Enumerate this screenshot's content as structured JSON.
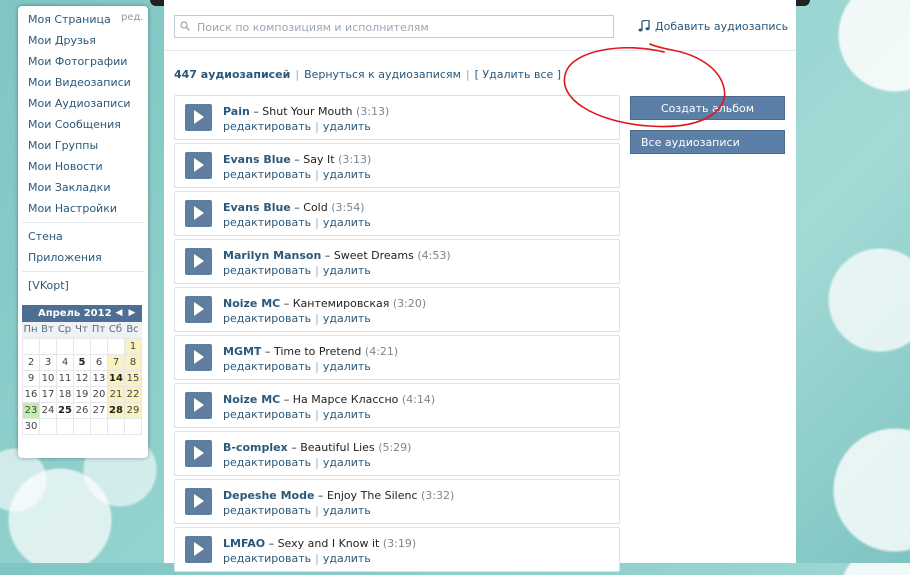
{
  "menu": {
    "edit_label": "ред.",
    "items": [
      {
        "label": "Моя Страница"
      },
      {
        "label": "Мои Друзья"
      },
      {
        "label": "Мои Фотографии"
      },
      {
        "label": "Мои Видеозаписи"
      },
      {
        "label": "Мои Аудиозаписи"
      },
      {
        "label": "Мои Сообщения"
      },
      {
        "label": "Мои Группы"
      },
      {
        "label": "Мои Новости"
      },
      {
        "label": "Мои Закладки"
      },
      {
        "label": "Мои Настройки"
      }
    ],
    "extra": [
      {
        "label": "Стена"
      },
      {
        "label": "Приложения"
      }
    ],
    "vkopt": "[VKopt]"
  },
  "calendar": {
    "title": "Апрель 2012",
    "prev_icon": "◀",
    "next_icon": "▶",
    "weekdays": [
      "Пн",
      "Вт",
      "Ср",
      "Чт",
      "Пт",
      "Сб",
      "Вс"
    ],
    "weeks": [
      [
        "",
        "",
        "",
        "",
        "",
        "",
        "1"
      ],
      [
        "2",
        "3",
        "4",
        "5",
        "6",
        "7",
        "8"
      ],
      [
        "9",
        "10",
        "11",
        "12",
        "13",
        "14",
        "15"
      ],
      [
        "16",
        "17",
        "18",
        "19",
        "20",
        "21",
        "22"
      ],
      [
        "23",
        "24",
        "25",
        "26",
        "27",
        "28",
        "29"
      ],
      [
        "30",
        "",
        "",
        "",
        "",
        "",
        ""
      ]
    ],
    "bold_days": [
      "5",
      "14",
      "25",
      "28"
    ],
    "today": "23",
    "weekend_color": "#fbf0c0",
    "today_color": "#c4ecb0"
  },
  "search": {
    "placeholder": "Поиск по композициям и исполнителям",
    "value": ""
  },
  "header": {
    "add_audio": "Добавить аудиозапись",
    "count": "447 аудиозаписей",
    "back": "Вернуться к аудиозаписям",
    "delete_all": "[ Удалить все ]",
    "separator": "|"
  },
  "track_actions": {
    "edit": "редактировать",
    "delete": "удалить",
    "separator": "|"
  },
  "tracks": [
    {
      "artist": "Pain",
      "title": "Shut Your Mouth",
      "duration": "(3:13)"
    },
    {
      "artist": "Evans Blue",
      "title": "Say It",
      "duration": "(3:13)"
    },
    {
      "artist": "Evans Blue",
      "title": "Cold",
      "duration": "(3:54)"
    },
    {
      "artist": "Marilyn Manson",
      "title": "Sweet Dreams",
      "duration": "(4:53)"
    },
    {
      "artist": "Noize MC",
      "title": "Кантемировская",
      "duration": "(3:20)"
    },
    {
      "artist": "MGMT",
      "title": "Time to Pretend",
      "duration": "(4:21)"
    },
    {
      "artist": "Noize MC",
      "title": "На Марсе Классно",
      "duration": "(4:14)"
    },
    {
      "artist": "B-complex",
      "title": "Beautiful Lies",
      "duration": "(5:29)"
    },
    {
      "artist": "Depeshe Mode",
      "title": "Enjoy The Silenc",
      "duration": "(3:32)"
    },
    {
      "artist": "LMFAO",
      "title": "Sexy and I Know it",
      "duration": "(3:19)"
    }
  ],
  "sidebar_buttons": {
    "create_album": "Создать альбом",
    "all_audio": "Все аудиозаписи"
  },
  "colors": {
    "link": "#2b587a",
    "button": "#5b7fa6",
    "annotation": "#e0161c"
  }
}
